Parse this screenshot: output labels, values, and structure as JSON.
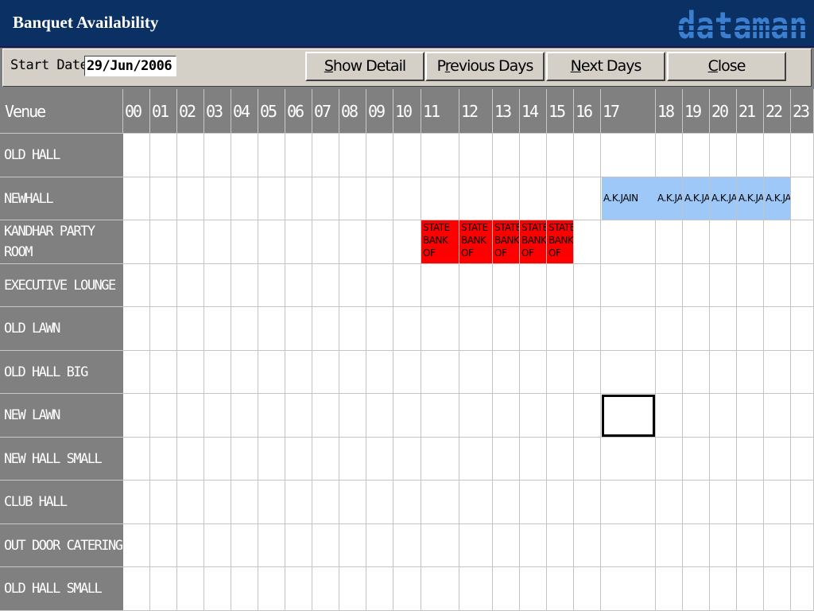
{
  "window": {
    "title": "Banquet Availability",
    "logo": "dataman"
  },
  "toolbar": {
    "start_date_label": "Start Date",
    "start_date_value": "29/Jun/2006",
    "buttons": [
      {
        "label": "Show Detail",
        "mnemonic": "S"
      },
      {
        "label": "Previous Days",
        "mnemonic": "r"
      },
      {
        "label": "Next Days",
        "mnemonic": "N"
      },
      {
        "label": "Close",
        "mnemonic": "C"
      }
    ]
  },
  "grid": {
    "venue_header": "Venue",
    "hours": [
      "00",
      "01",
      "02",
      "03",
      "04",
      "05",
      "06",
      "07",
      "08",
      "09",
      "10",
      "11",
      "12",
      "13",
      "14",
      "15",
      "16",
      "17",
      "18",
      "19",
      "20",
      "21",
      "22",
      "23"
    ],
    "venues": [
      "OLD HALL",
      "NEWHALL",
      "KANDHAR PARTY ROOM",
      "EXECUTIVE LOUNGE",
      "OLD LAWN",
      "OLD HALL BIG",
      "NEW LAWN",
      "NEW HALL SMALL",
      "CLUB HALL",
      "OUT DOOR CATERING",
      "OLD HALL SMALL"
    ],
    "bookings": [
      {
        "venue": 1,
        "hour": 17,
        "text": "A.K.JAIN",
        "color": "#9ec8f8"
      },
      {
        "venue": 1,
        "hour": 18,
        "text": "A.K.JAIN",
        "color": "#9ec8f8"
      },
      {
        "venue": 1,
        "hour": 19,
        "text": "A.K.JAIN",
        "color": "#9ec8f8"
      },
      {
        "venue": 1,
        "hour": 20,
        "text": "A.K.JAIN",
        "color": "#9ec8f8"
      },
      {
        "venue": 1,
        "hour": 21,
        "text": "A.K.JAIN",
        "color": "#9ec8f8"
      },
      {
        "venue": 1,
        "hour": 22,
        "text": "A.K.JAIN",
        "color": "#9ec8f8"
      },
      {
        "venue": 2,
        "hour": 11,
        "text": "STATE BANK OF",
        "color": "#ff0000"
      },
      {
        "venue": 2,
        "hour": 12,
        "text": "STATE BANK OF",
        "color": "#ff0000"
      },
      {
        "venue": 2,
        "hour": 13,
        "text": "STATE BANK OF",
        "color": "#ff0000"
      },
      {
        "venue": 2,
        "hour": 14,
        "text": "STATE BANK OF",
        "color": "#ff0000"
      },
      {
        "venue": 2,
        "hour": 15,
        "text": "STATE BANK OF",
        "color": "#ff0000"
      }
    ],
    "selected": {
      "venue": 6,
      "hour": 17
    }
  }
}
